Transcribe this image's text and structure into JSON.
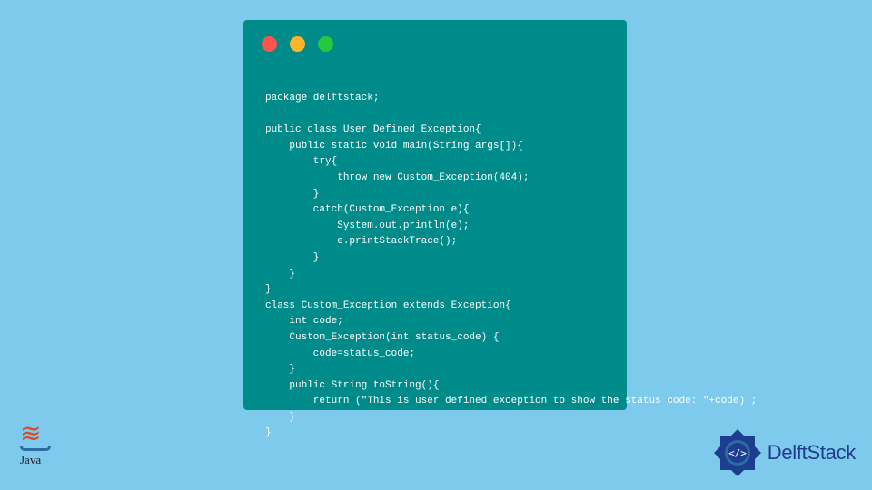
{
  "colors": {
    "background": "#7ecaed",
    "window": "#008b8b",
    "dot_red": "#ff544d",
    "dot_yellow": "#ffb429",
    "dot_green": "#25c93f",
    "code_text": "#ffffff",
    "java_accent": "#d84b2a",
    "java_blue": "#2d6ca2",
    "delftstack_blue": "#1d3e8f"
  },
  "code": {
    "content": "package delftstack;\n\npublic class User_Defined_Exception{\n    public static void main(String args[]){\n        try{\n            throw new Custom_Exception(404);\n        }\n        catch(Custom_Exception e){\n            System.out.println(e);\n            e.printStackTrace();\n        }\n    }\n}\nclass Custom_Exception extends Exception{\n    int code;\n    Custom_Exception(int status_code) {\n        code=status_code;\n    }\n    public String toString(){\n        return (\"This is user defined exception to show the status code: \"+code) ;\n    }\n}"
  },
  "logos": {
    "java_label": "Java",
    "delftstack_label": "DelftStack",
    "delftstack_glyph": "</>"
  }
}
